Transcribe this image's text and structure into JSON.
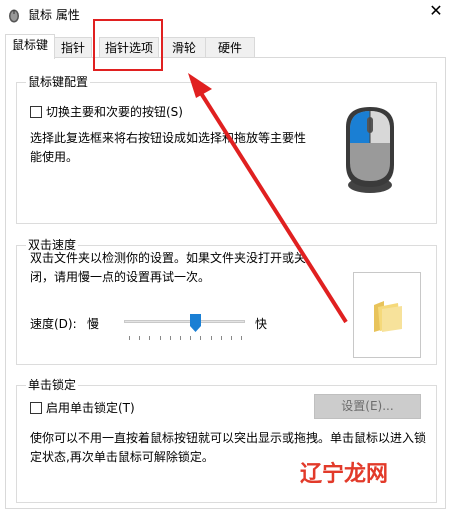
{
  "window": {
    "title": "鼠标 属性",
    "close_label": "✕"
  },
  "tabs": [
    {
      "label": "鼠标键",
      "active": true
    },
    {
      "label": "指针",
      "active": false
    },
    {
      "label": "指针选项",
      "active": false
    },
    {
      "label": "滑轮",
      "active": false
    },
    {
      "label": "硬件",
      "active": false
    }
  ],
  "button_config": {
    "group_title": "鼠标键配置",
    "switch_checkbox_label": "切换主要和次要的按钮(S)",
    "switch_checked": false,
    "description": "选择此复选框来将右按钮设成如选择和拖放等主要性能使用。"
  },
  "double_click": {
    "group_title": "双击速度",
    "description": "双击文件夹以检测你的设置。如果文件夹没打开或关闭，请用慢一点的设置再试一次。",
    "speed_label": "速度(D):",
    "slow_label": "慢",
    "fast_label": "快",
    "speed_value_fraction": 0.6
  },
  "click_lock": {
    "group_title": "单击锁定",
    "checkbox_label": "启用单击锁定(T)",
    "checked": false,
    "settings_button_label": "设置(E)...",
    "description": "使你可以不用一直按着鼠标按钮就可以突出显示或拖拽。单击鼠标以进入锁定状态,再次单击鼠标可解除锁定。"
  },
  "watermark": {
    "text": "辽宁龙网"
  },
  "colors": {
    "accent": "#1a7fd4",
    "annotation": "#e02020",
    "watermark": "#e23a2a"
  }
}
